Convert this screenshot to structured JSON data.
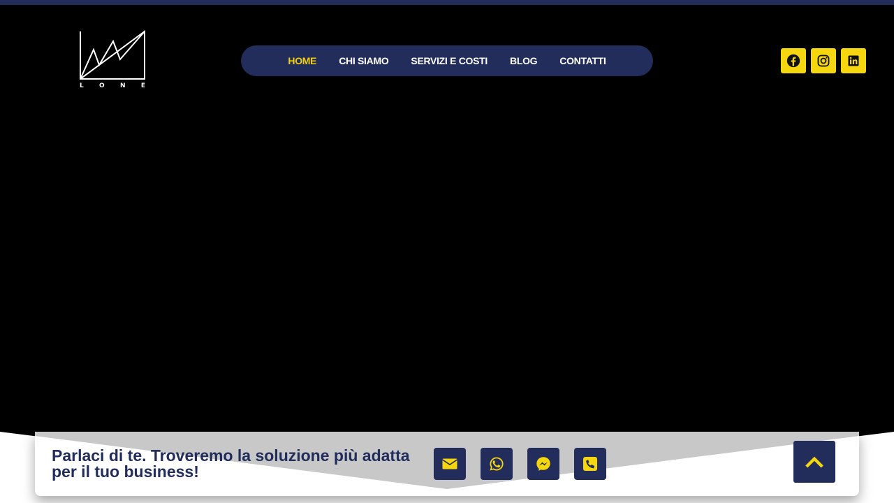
{
  "brand": {
    "logo_text": [
      "L",
      "O",
      "N",
      "E"
    ]
  },
  "nav": {
    "items": [
      {
        "label": "HOME",
        "active": true
      },
      {
        "label": "CHI SIAMO",
        "active": false
      },
      {
        "label": "SERVIZI E COSTI",
        "active": false
      },
      {
        "label": "BLOG",
        "active": false
      },
      {
        "label": "CONTATTI",
        "active": false
      }
    ]
  },
  "socials": [
    {
      "icon": "facebook-icon"
    },
    {
      "icon": "instagram-icon"
    },
    {
      "icon": "linkedin-icon"
    }
  ],
  "contact_bar": {
    "text": "Parlaci di te. Troveremo la soluzione più adatta per il tuo business!",
    "icons": [
      "envelope-icon",
      "whatsapp-icon",
      "messenger-icon",
      "phone-icon"
    ]
  },
  "colors": {
    "background": "#000000",
    "navy": "#222d5c",
    "accent_yellow": "#f5d60f",
    "bar_gray": "#c8c8c8"
  }
}
